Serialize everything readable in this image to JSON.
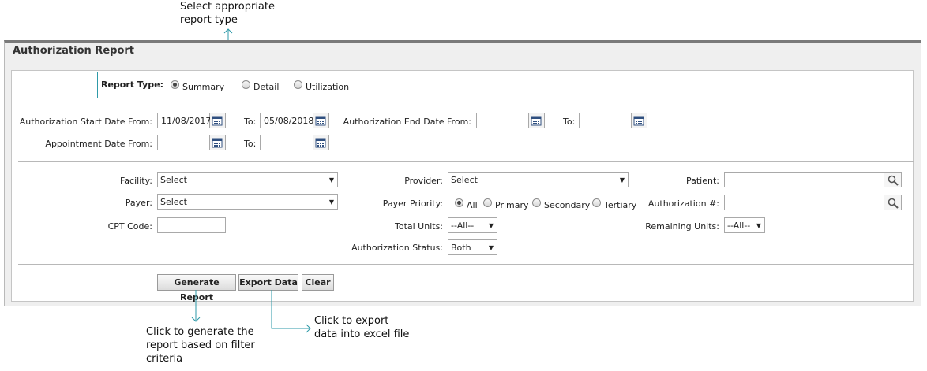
{
  "callouts": {
    "report_type_line1": "Select appropriate",
    "report_type_line2": "report type",
    "generate_line1": "Click to generate the",
    "generate_line2": "report based on filter",
    "generate_line3": "criteria",
    "export_line1": "Click to export",
    "export_line2": "data into excel file"
  },
  "panel": {
    "title": "Authorization Report"
  },
  "report_type": {
    "label": "Report Type:",
    "options": [
      "Summary",
      "Detail",
      "Utilization"
    ],
    "selected": "Summary"
  },
  "dates": {
    "auth_start_from_label": "Authorization Start Date From:",
    "auth_start_from_value": "11/08/2017",
    "auth_start_to_label": "To:",
    "auth_start_to_value": "05/08/2018",
    "auth_end_from_label": "Authorization End Date From:",
    "auth_end_from_value": "",
    "auth_end_to_label": "To:",
    "auth_end_to_value": "",
    "appt_from_label": "Appointment Date From:",
    "appt_from_value": "",
    "appt_to_label": "To:",
    "appt_to_value": ""
  },
  "filters": {
    "facility_label": "Facility:",
    "facility_value": "Select",
    "payer_label": "Payer:",
    "payer_value": "Select",
    "cpt_label": "CPT Code:",
    "cpt_value": "",
    "provider_label": "Provider:",
    "provider_value": "Select",
    "payer_priority_label": "Payer Priority:",
    "payer_priority_options": [
      "All",
      "Primary",
      "Secondary",
      "Tertiary"
    ],
    "payer_priority_selected": "All",
    "total_units_label": "Total Units:",
    "total_units_value": "--All--",
    "auth_status_label": "Authorization Status:",
    "auth_status_value": "Both",
    "patient_label": "Patient:",
    "patient_value": "",
    "auth_num_label": "Authorization #:",
    "auth_num_value": "",
    "remaining_units_label": "Remaining Units:",
    "remaining_units_value": "--All--"
  },
  "buttons": {
    "generate": "Generate Report",
    "export": "Export Data",
    "clear": "Clear"
  },
  "colors": {
    "callout_line": "#2e9aa8",
    "panel_bg": "#efefef"
  }
}
